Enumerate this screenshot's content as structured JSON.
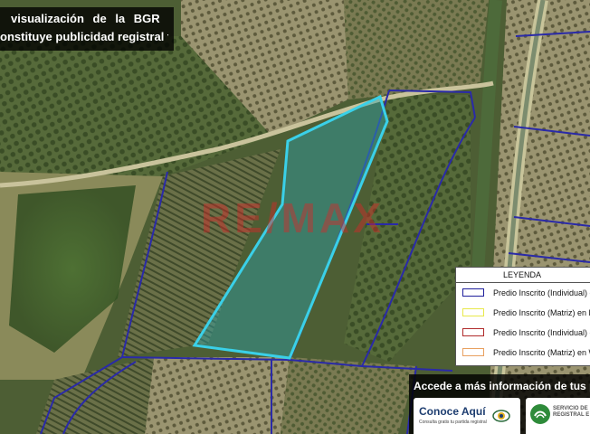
{
  "disclaimer": {
    "line1": "visualización de la BGR no",
    "line2": "onstituye publicidad registral formal"
  },
  "watermark": {
    "text": "RE/MAX"
  },
  "legend": {
    "title": "LEYENDA",
    "items": [
      {
        "label": "Predio Inscrito (Individual) en",
        "color": "#1f1f9c"
      },
      {
        "label": "Predio Inscrito (Matriz) en PS",
        "color": "#e8e84a"
      },
      {
        "label": "Predio Inscrito (Individual) en",
        "color": "#b02a2a"
      },
      {
        "label": "Predio Inscrito (Matriz) en WO",
        "color": "#e8a060"
      }
    ]
  },
  "banner": {
    "title": "Accede a más información de tus pan",
    "conoce_main": "Conoce Aquí",
    "conoce_sub": "Consulta gratis tu partida registral",
    "sunarp_line1": "SERVICIO DE",
    "sunarp_line2": "REGISTRAL E"
  },
  "colors": {
    "highlight_outline": "#3ad0e8",
    "highlight_fill": "#2aa8b0",
    "parcel_outline": "#2a2aa8"
  }
}
